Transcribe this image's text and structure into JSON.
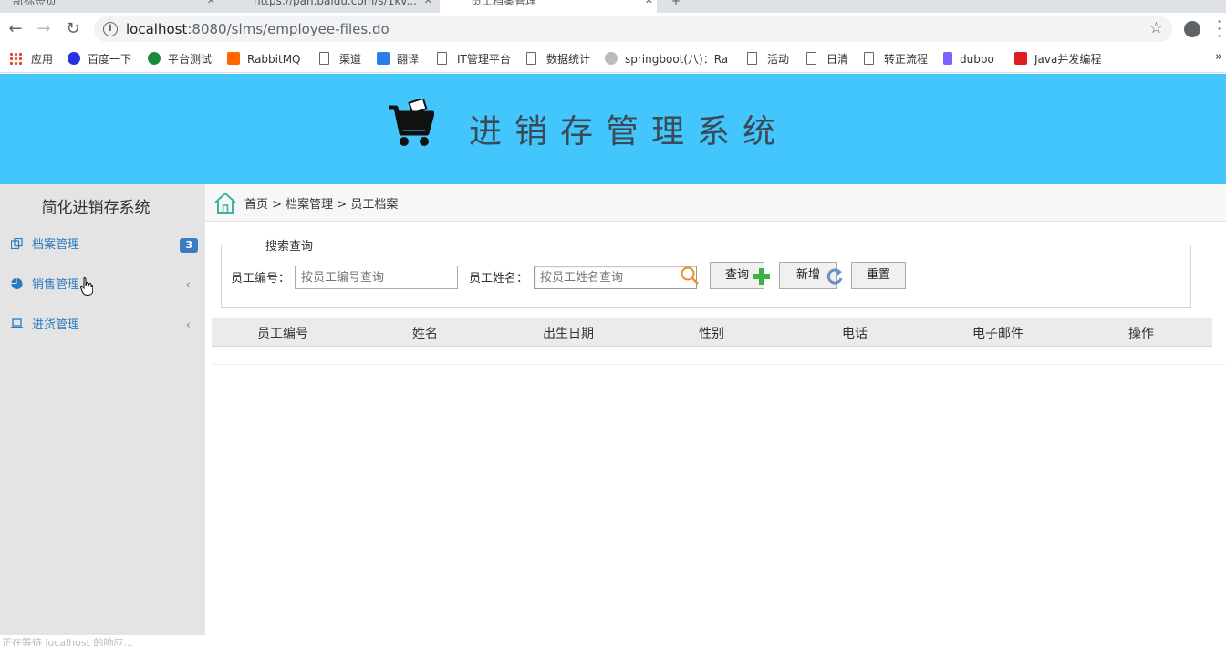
{
  "browser": {
    "tabs": [
      {
        "label": "新标签页"
      },
      {
        "label": "https://pan.baidu.com/s/1kv..."
      },
      {
        "label": "员工档案管理"
      }
    ],
    "url_host": "localhost",
    "url_rest": ":8080/slms/employee-files.do",
    "bookmarks": [
      {
        "label": "应用",
        "icon": "apps-grid-icon"
      },
      {
        "label": "百度一下",
        "icon": "baidu-paw-icon",
        "color": "#2932e1"
      },
      {
        "label": "平台测试",
        "icon": "globe-icon",
        "color": "#1d8a3a"
      },
      {
        "label": "RabbitMQ",
        "icon": "rabbitmq-icon",
        "color": "#ff6600"
      },
      {
        "label": "渠道",
        "icon": "document-icon"
      },
      {
        "label": "翻译",
        "icon": "translate-icon",
        "color": "#2b7de9"
      },
      {
        "label": "IT管理平台",
        "icon": "document-icon"
      },
      {
        "label": "数据统计",
        "icon": "document-icon"
      },
      {
        "label": "springboot(八)：Ra",
        "icon": "database-icon",
        "color": "#999999"
      },
      {
        "label": "活动",
        "icon": "document-icon"
      },
      {
        "label": "日清",
        "icon": "document-icon"
      },
      {
        "label": "转正流程",
        "icon": "document-icon"
      },
      {
        "label": "dubbo",
        "icon": "dubbo-icon",
        "color": "#7b61ff"
      },
      {
        "label": "Java并发编程",
        "icon": "csdn-icon",
        "color": "#e01c1c"
      }
    ],
    "more": "»",
    "status_text": "正在等待 localhost 的响应..."
  },
  "app": {
    "title": "进销存管理系统",
    "header_color": "#43c6fb"
  },
  "sidebar": {
    "title": "简化进销存系统",
    "items": [
      {
        "label": "档案管理",
        "badge": "3",
        "icon": "copy-icon"
      },
      {
        "label": "销售管理",
        "chevron": "‹",
        "icon": "pie-chart-icon"
      },
      {
        "label": "进货管理",
        "chevron": "‹",
        "icon": "laptop-icon"
      }
    ]
  },
  "breadcrumb": "首页 > 档案管理 > 员工档案",
  "search": {
    "legend": "搜索查询",
    "emp_no_label": "员工编号：",
    "emp_no_placeholder": "按员工编号查询",
    "emp_name_label": "员工姓名：",
    "emp_name_placeholder": "按员工姓名查询",
    "query_button": "查询",
    "add_button": "新增",
    "reset_button": "重置"
  },
  "table": {
    "columns": [
      "员工编号",
      "姓名",
      "出生日期",
      "性别",
      "电话",
      "电子邮件",
      "操作"
    ],
    "rows": []
  }
}
